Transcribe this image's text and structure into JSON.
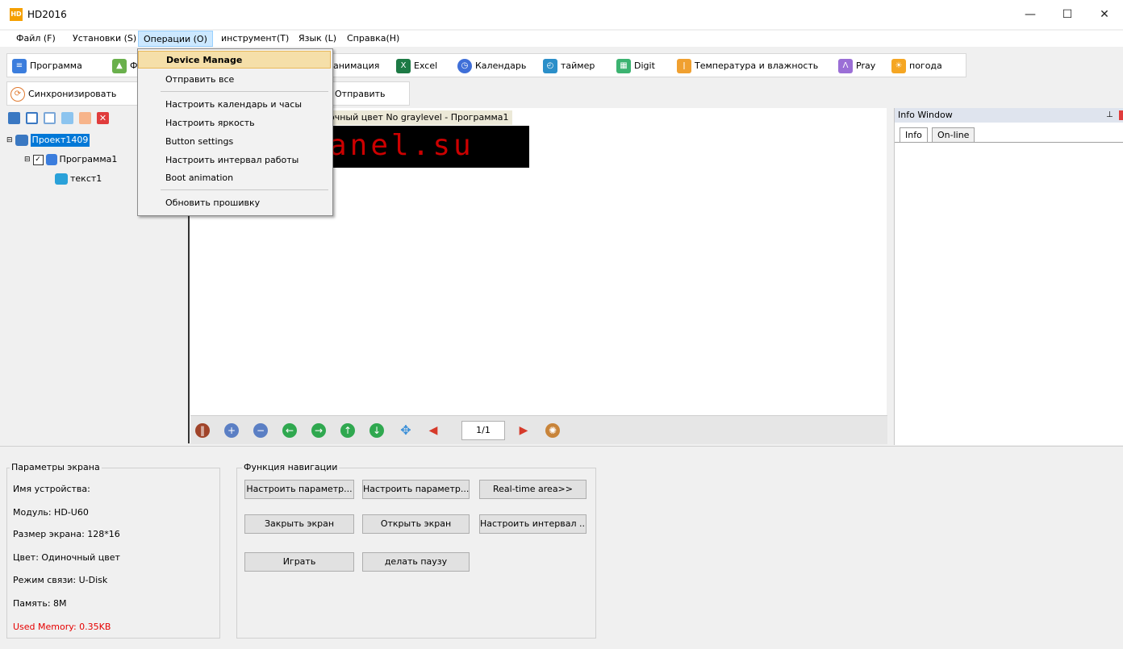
{
  "window": {
    "title": "HD2016",
    "app_icon_text": "HD",
    "minimize": "—",
    "maximize": "☐",
    "close": "✕"
  },
  "menu": [
    "Файл (F)",
    "Установки (S)",
    "Операции (O)",
    "инструмент(T)",
    "Язык (L)",
    "Справка(H)"
  ],
  "toolbar1": {
    "program": "Программа",
    "photo_partial": "Ф",
    "animation": "анимация",
    "excel": "Excel",
    "calendar": "Календарь",
    "timer": "таймер",
    "digit": "Digit",
    "temperature": "Температура и влажность",
    "pray": "Pray",
    "weather": "погода"
  },
  "toolbar2": {
    "sync": "Синхронизировать",
    "send": "Отправить"
  },
  "dropdown": [
    "Device Manage",
    "Отправить все",
    "Настроить календарь и часы",
    "Настроить яркость",
    "Button settings",
    "Настроить интервал работы",
    "Boot animation",
    "Обновить прошивку"
  ],
  "tree": {
    "project": "Проект1409",
    "program": "Программа1",
    "text": "текст1"
  },
  "canvas": {
    "header": "очный цвет No graylevel - Программа1",
    "led_text": "anel.su"
  },
  "navbar": {
    "page": "1/1"
  },
  "info_window": {
    "title": "Info Window",
    "pin": "ꟷ",
    "tabs": [
      "Info",
      "On-line"
    ]
  },
  "screen_params": {
    "title": "Параметры экрана",
    "device_name": "Имя устройства:",
    "module": "Модуль: HD-U60",
    "size": "Размер экрана: 128*16",
    "color": "Цвет: Одиночный цвет",
    "comm": "Режим связи: U-Disk",
    "memory": "Память: 8M",
    "used": "Used Memory: 0.35KB"
  },
  "navigation": {
    "title": "Функция навигации",
    "set_param1": "Настроить параметр...",
    "set_param2": "Настроить параметр...",
    "realtime": "Real-time area>>",
    "close_screen": "Закрыть экран",
    "open_screen": "Открыть экран",
    "set_interval": "Настроить интервал ...",
    "play": "Играть",
    "pause": "делать паузу"
  },
  "colors": {
    "used_memory": "#e60000",
    "led": "#cc0000",
    "highlight": "#f5dfa9",
    "accent": "#0078d7"
  }
}
